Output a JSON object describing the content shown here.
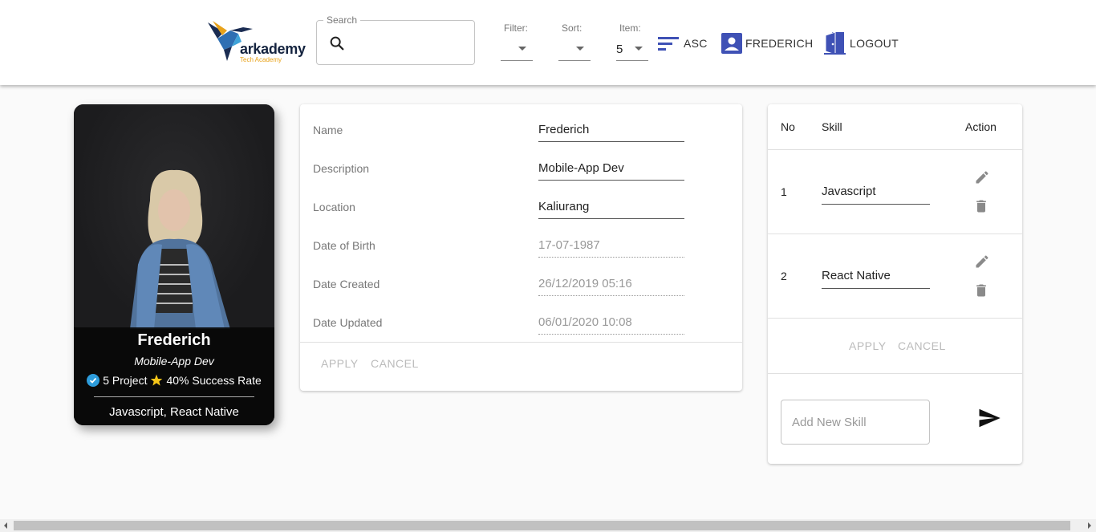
{
  "header": {
    "logo_text": "arkademy",
    "logo_sub": "Tech Academy",
    "search": {
      "label": "Search",
      "value": ""
    },
    "filter": {
      "label": "Filter:",
      "value": ""
    },
    "sort": {
      "label": "Sort:",
      "value": ""
    },
    "item": {
      "label": "Item:",
      "value": "5"
    },
    "order_label": "ASC",
    "user_label": "FREDERICH",
    "logout_label": "LOGOUT"
  },
  "profile": {
    "name": "Frederich",
    "role": "Mobile-App Dev",
    "projects": "5 Project",
    "success": "40% Success Rate",
    "skills": "Javascript, React Native"
  },
  "details": {
    "fields": [
      {
        "label": "Name",
        "value": "Frederich",
        "disabled": false
      },
      {
        "label": "Description",
        "value": "Mobile-App Dev",
        "disabled": false
      },
      {
        "label": "Location",
        "value": "Kaliurang",
        "disabled": false
      },
      {
        "label": "Date of Birth",
        "value": "17-07-1987",
        "disabled": true
      },
      {
        "label": "Date Created",
        "value": "26/12/2019 05:16",
        "disabled": true
      },
      {
        "label": "Date Updated",
        "value": "06/01/2020 10:08",
        "disabled": true
      }
    ],
    "apply_label": "APPLY",
    "cancel_label": "CANCEL"
  },
  "skills": {
    "headers": {
      "no": "No",
      "skill": "Skill",
      "action": "Action"
    },
    "rows": [
      {
        "no": "1",
        "skill": "Javascript"
      },
      {
        "no": "2",
        "skill": "React Native"
      }
    ],
    "apply_label": "APPLY",
    "cancel_label": "CANCEL",
    "new_skill_placeholder": "Add New Skill"
  },
  "colors": {
    "accent": "#3f51b5",
    "logo_dark": "#14233f",
    "logo_orange": "#e8a21a"
  }
}
